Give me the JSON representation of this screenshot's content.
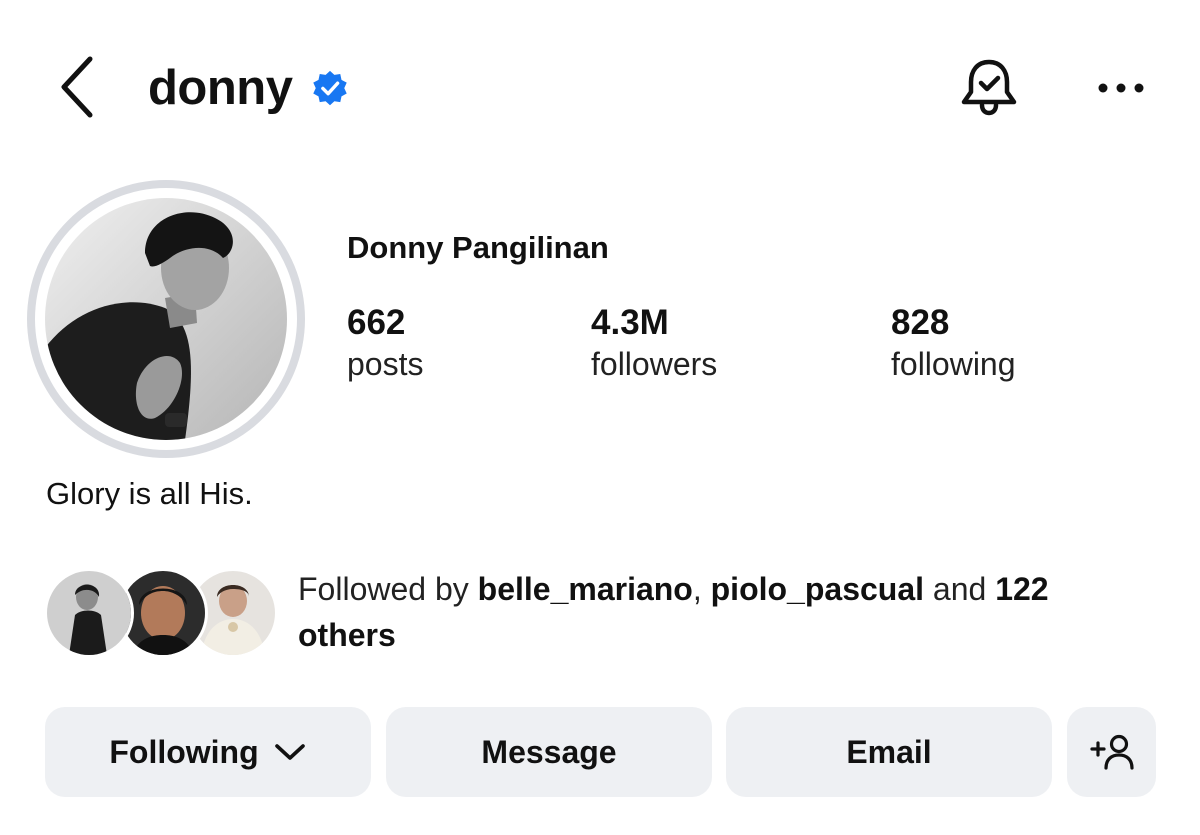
{
  "header": {
    "username": "donny",
    "verified": true,
    "back_icon": "chevron-left-icon",
    "bell_icon": "bell-check-icon",
    "more_icon": "more-horizontal-icon",
    "accent_color": "#1877F2"
  },
  "profile": {
    "full_name": "Donny Pangilinan",
    "bio": "Glory is all His.",
    "stats": [
      {
        "value": "662",
        "label": "posts"
      },
      {
        "value": "4.3M",
        "label": "followers"
      },
      {
        "value": "828",
        "label": "following"
      }
    ]
  },
  "followed_by": {
    "prefix": "Followed by ",
    "user1": "belle_mariano",
    "separator": ", ",
    "user2": "piolo_pascual",
    "middle": " and ",
    "count": "122",
    "suffix": "others"
  },
  "actions": {
    "following_label": "Following",
    "message_label": "Message",
    "email_label": "Email",
    "add_person_icon": "add-person-icon"
  }
}
